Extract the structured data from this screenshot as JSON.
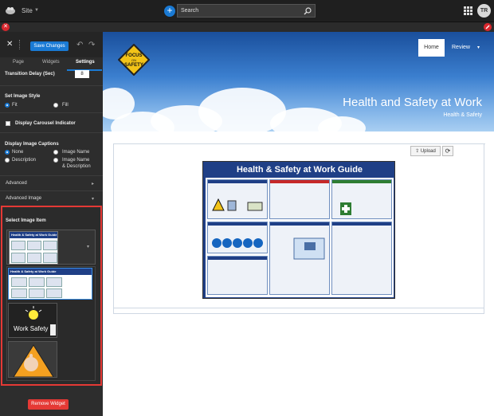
{
  "topbar": {
    "site_label": "Site",
    "search_placeholder": "Search",
    "avatar_initials": "TR"
  },
  "panel": {
    "save_label": "Save Changes",
    "tabs": [
      {
        "label": "Page"
      },
      {
        "label": "Widgets"
      },
      {
        "label": "Settings"
      }
    ],
    "transition_delay_label": "Transition Delay (Sec)",
    "transition_delay_value": "8",
    "image_style_label": "Set Image Style",
    "image_style_options": [
      "Fit",
      "Fill"
    ],
    "carousel_indicator_label": "Display Carousel Indicator",
    "captions_label": "Display Image Captions",
    "captions_options": [
      "None",
      "Image Name",
      "Description",
      "Image Name",
      "& Description"
    ],
    "advanced_label": "Advanced",
    "advanced_image_label": "Advanced Image",
    "select_image_label": "Select Image Item",
    "thumb_title": "Health & Safety at Work Guide",
    "list_items": [
      "Work Safety"
    ],
    "remove_label": "Remove Widget"
  },
  "page": {
    "nav_items": [
      "Home",
      "Review"
    ],
    "badge_lines": [
      "FOCUS",
      "ON",
      "SAFETY"
    ],
    "hero_title": "Health and Safety at Work",
    "hero_subtitle": "Health & Safety",
    "upload_label": "Upload",
    "poster_title": "Health & Safety at Work Guide"
  },
  "colors": {
    "accent_blue": "#1a7ad4",
    "danger_red": "#e53935",
    "poster_navy": "#1f3f86"
  }
}
